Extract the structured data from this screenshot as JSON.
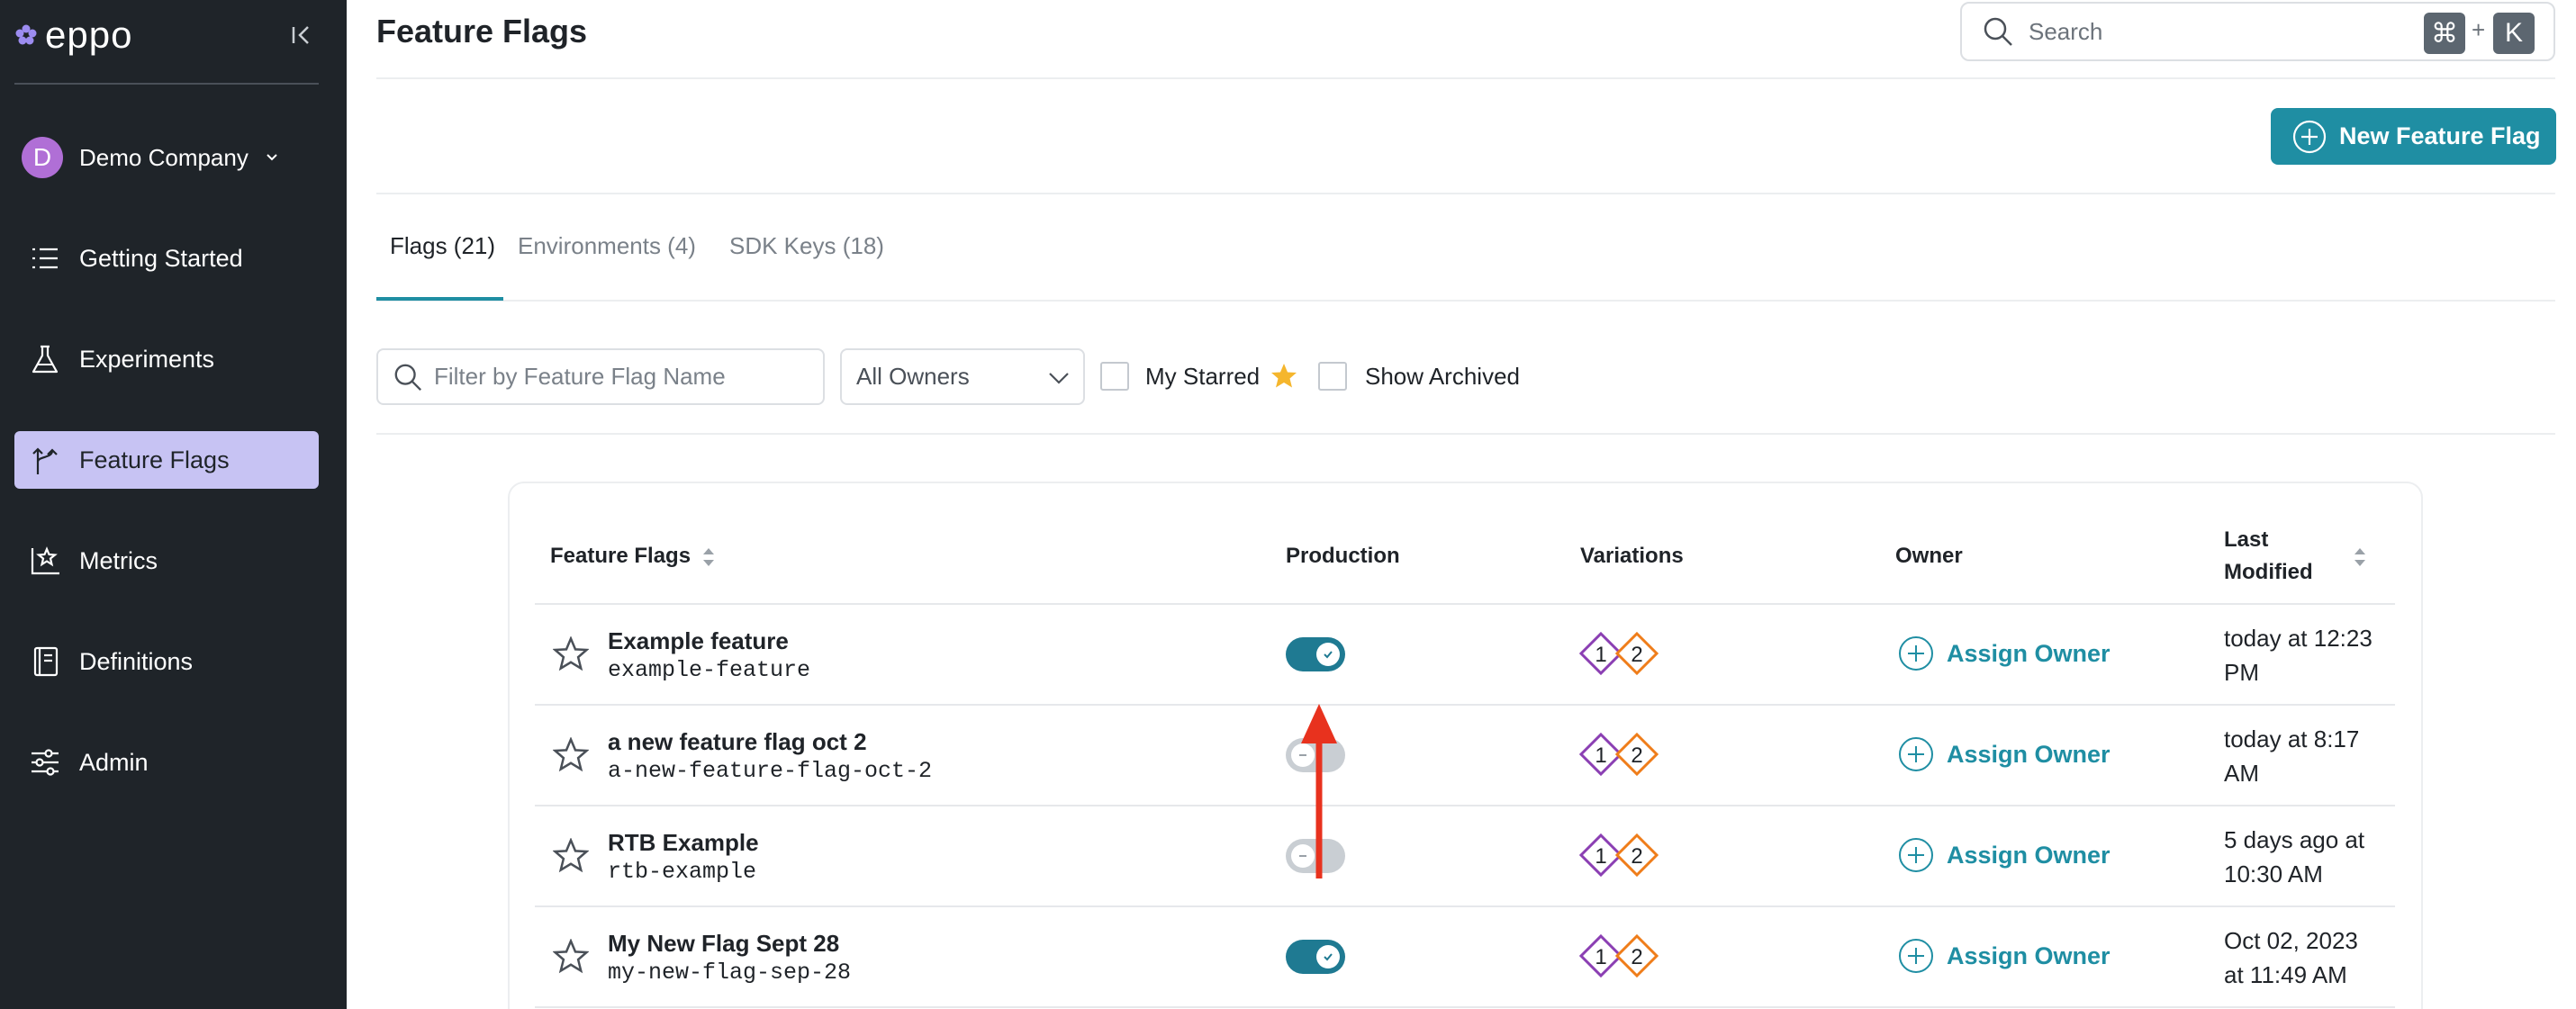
{
  "brand": {
    "name": "eppo"
  },
  "sidebar": {
    "company": {
      "initial": "D",
      "name": "Demo Company"
    },
    "items": [
      {
        "label": "Getting Started",
        "icon": "list-icon"
      },
      {
        "label": "Experiments",
        "icon": "beaker-icon"
      },
      {
        "label": "Feature Flags",
        "icon": "branch-icon",
        "active": true
      },
      {
        "label": "Metrics",
        "icon": "metrics-icon"
      },
      {
        "label": "Definitions",
        "icon": "book-icon"
      },
      {
        "label": "Admin",
        "icon": "sliders-icon"
      }
    ]
  },
  "header": {
    "title": "Feature Flags",
    "search": {
      "placeholder": "Search",
      "shortcut_key1": "⌘",
      "shortcut_plus": "+",
      "shortcut_key2": "K"
    },
    "new_button": "New Feature Flag"
  },
  "tabs": [
    {
      "label": "Flags (21)",
      "active": true
    },
    {
      "label": "Environments (4)"
    },
    {
      "label": "SDK Keys (18)"
    }
  ],
  "filters": {
    "name_placeholder": "Filter by Feature Flag Name",
    "owners_selected": "All Owners",
    "my_starred": "My Starred",
    "show_archived": "Show Archived"
  },
  "table": {
    "headers": {
      "name": "Feature Flags",
      "production": "Production",
      "variations": "Variations",
      "owner": "Owner",
      "modified_line1": "Last",
      "modified_line2": "Modified"
    },
    "rows": [
      {
        "name": "Example feature",
        "key": "example-feature",
        "production": true,
        "v1": "1",
        "v2": "2",
        "owner": "Assign Owner",
        "mod1": "today at 12:23",
        "mod2": "PM"
      },
      {
        "name": "a new feature flag oct 2",
        "key": "a-new-feature-flag-oct-2",
        "production": false,
        "v1": "1",
        "v2": "2",
        "owner": "Assign Owner",
        "mod1": "today at 8:17",
        "mod2": "AM"
      },
      {
        "name": "RTB Example",
        "key": "rtb-example",
        "production": false,
        "v1": "1",
        "v2": "2",
        "owner": "Assign Owner",
        "mod1": "5 days ago at",
        "mod2": "10:30 AM"
      },
      {
        "name": "My New Flag Sept 28",
        "key": "my-new-flag-sep-28",
        "production": true,
        "v1": "1",
        "v2": "2",
        "owner": "Assign Owner",
        "mod1": "Oct 02, 2023",
        "mod2": "at 11:49 AM"
      }
    ]
  },
  "colors": {
    "accent": "#1f8ea3",
    "sidebar": "#1f2429",
    "active_nav": "#c7c3f3",
    "annotation_arrow": "#e8321e"
  }
}
